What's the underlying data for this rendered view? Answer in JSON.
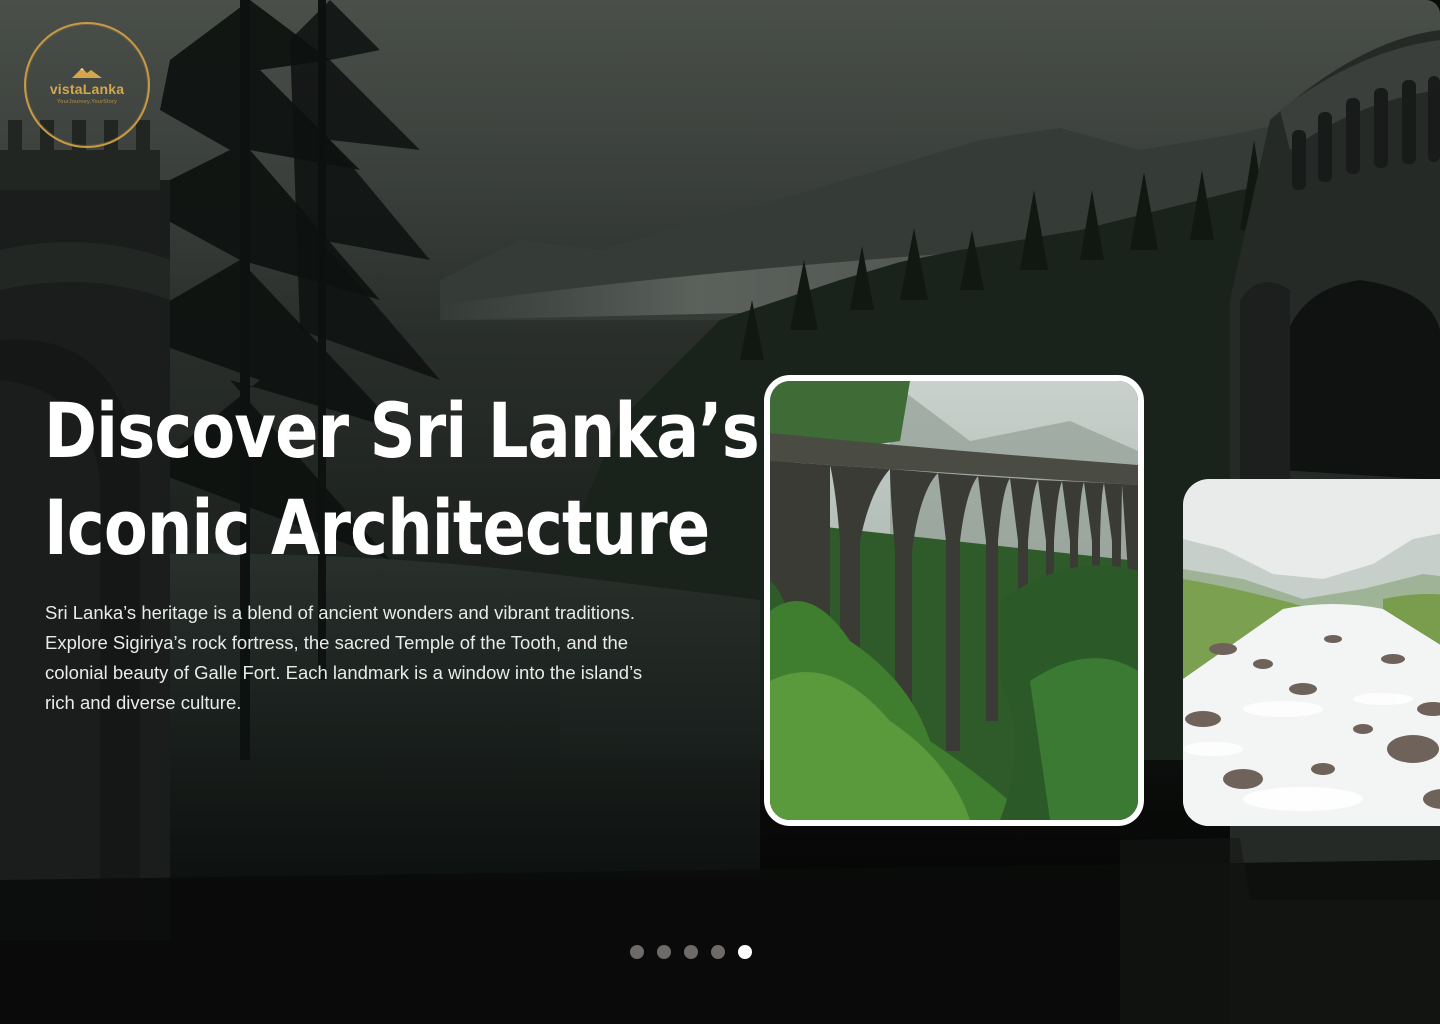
{
  "brand": {
    "name": "vistaLanka",
    "tagline": "YourJourney,YourStory",
    "accent_color": "#c79a45"
  },
  "hero": {
    "title_line1": "Discover Sri Lanka’s",
    "title_line2": "Iconic Architecture",
    "description": "Sri Lanka’s heritage is a blend of ancient wonders and vibrant traditions. Explore Sigiriya’s rock fortress, the sacred Temple of the Tooth, and the colonial beauty of Galle Fort. Each landmark is a window into the island’s rich and diverse culture."
  },
  "carousel": {
    "cards": [
      {
        "subject": "stone arch bridge in forest",
        "active": true
      },
      {
        "subject": "mountain river rapids",
        "active": false
      }
    ],
    "dots": [
      {
        "active": false
      },
      {
        "active": false
      },
      {
        "active": false
      },
      {
        "active": false
      },
      {
        "active": true
      }
    ]
  }
}
